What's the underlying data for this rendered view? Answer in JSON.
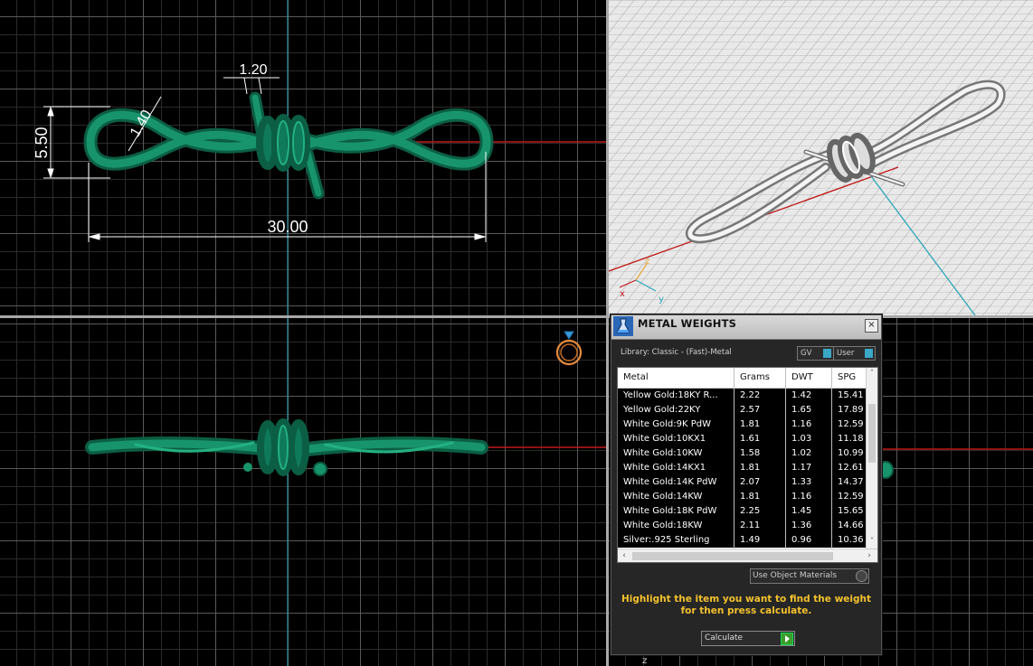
{
  "viewport_top": {
    "dimensions": {
      "height": "5.50",
      "wire": "1.40",
      "barb": "1.20",
      "length": "30.00"
    }
  },
  "viewport_persp": {
    "axis_labels": {
      "x": "x",
      "y": "y",
      "z": "z"
    }
  },
  "viewport_bottom_right": {
    "axis_label": "z"
  },
  "panel": {
    "title": "METAL WEIGHTS",
    "close_label": "×",
    "library": "Library: Classic - (Fast)-Metal",
    "toggle_gv": "GV",
    "toggle_user": "User",
    "columns": [
      "Metal",
      "Grams",
      "DWT",
      "SPG"
    ],
    "rows": [
      [
        "Yellow Gold:18KY R...",
        "2.22",
        "1.42",
        "15.41"
      ],
      [
        "Yellow Gold:22KY",
        "2.57",
        "1.65",
        "17.89"
      ],
      [
        "White Gold:9K PdW",
        "1.81",
        "1.16",
        "12.59"
      ],
      [
        "White Gold:10KX1",
        "1.61",
        "1.03",
        "11.18"
      ],
      [
        "White Gold:10KW",
        "1.58",
        "1.02",
        "10.99"
      ],
      [
        "White Gold:14KX1",
        "1.81",
        "1.17",
        "12.61"
      ],
      [
        "White Gold:14K PdW",
        "2.07",
        "1.33",
        "14.37"
      ],
      [
        "White Gold:14KW",
        "1.81",
        "1.16",
        "12.59"
      ],
      [
        "White Gold:18K PdW",
        "2.25",
        "1.45",
        "15.65"
      ],
      [
        "White Gold:18KW",
        "2.11",
        "1.36",
        "14.66"
      ],
      [
        "Silver:.925 Sterling",
        "1.49",
        "0.96",
        "10.36"
      ]
    ],
    "scroll_up": "˄",
    "scroll_down": "˅",
    "scroll_left": "‹",
    "scroll_right": "›",
    "object_materials": "Use Object Materials",
    "hint_line1": "Highlight the item you want to find the weight",
    "hint_line2": "for then press calculate.",
    "calculate": "Calculate"
  },
  "colors": {
    "model": "#0f7a5a",
    "model_light": "#1fa27a",
    "axis_red": "#c01818",
    "axis_cyan": "#2aa6b8",
    "hint": "#f2c12e"
  }
}
